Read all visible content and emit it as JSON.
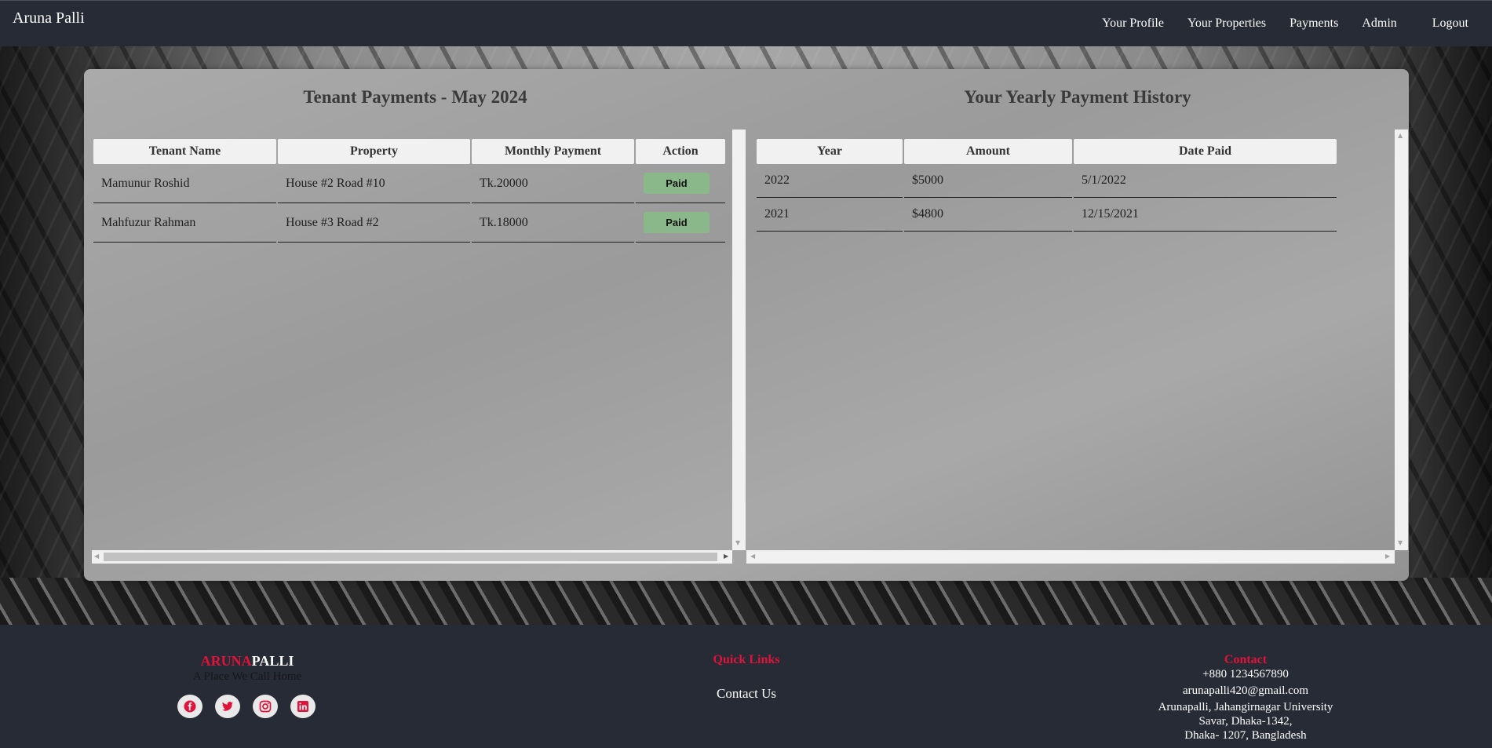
{
  "navbar": {
    "brand": "Aruna Palli",
    "links": [
      "Your Profile",
      "Your Properties",
      "Payments",
      "Admin",
      "Logout"
    ]
  },
  "tenant_payments": {
    "title": "Tenant Payments - May 2024",
    "headers": [
      "Tenant Name",
      "Property",
      "Monthly Payment",
      "Action"
    ],
    "rows": [
      {
        "name": "Mamunur Roshid",
        "property": "House #2 Road #10",
        "payment": "Tk.20000",
        "action": "Paid"
      },
      {
        "name": "Mahfuzur Rahman",
        "property": "House #3 Road #2",
        "payment": "Tk.18000",
        "action": "Paid"
      }
    ]
  },
  "yearly_history": {
    "title": "Your Yearly Payment History",
    "headers": [
      "Year",
      "Amount",
      "Date Paid"
    ],
    "rows": [
      {
        "year": "2022",
        "amount": "$5000",
        "date": "5/1/2022"
      },
      {
        "year": "2021",
        "amount": "$4800",
        "date": "12/15/2021"
      }
    ]
  },
  "footer": {
    "brand_red": "ARUNA",
    "brand_white": "PALLI",
    "tagline": "A Place We Call Home",
    "socials": [
      "facebook-icon",
      "twitter-icon",
      "instagram-icon",
      "linkedin-icon"
    ],
    "quick_links_title": "Quick Links",
    "quick_links": [
      "Contact Us"
    ],
    "contact_title": "Contact",
    "phone": "+880 1234567890",
    "email": "arunapalli420@gmail.com",
    "address_line1": "Arunapalli, Jahangirnagar University",
    "address_line2": "Savar, Dhaka-1342,",
    "address_line3": "Dhaka- 1207, Bangladesh"
  },
  "colors": {
    "accent": "#e0133b",
    "navbar_bg": "#272b35",
    "paid_button": "#8bb88a"
  }
}
